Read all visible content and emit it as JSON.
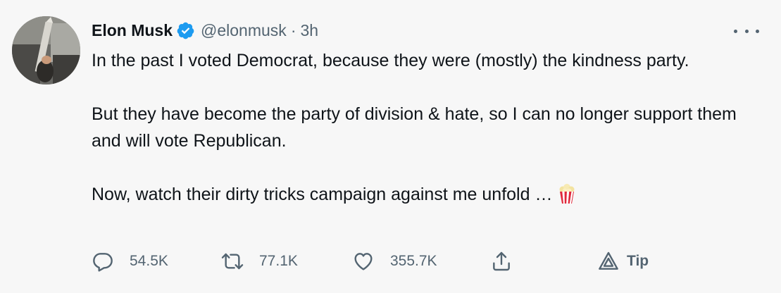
{
  "author": {
    "name": "Elon Musk",
    "handle": "@elonmusk",
    "separator": "·",
    "time": "3h",
    "verified": true,
    "avatar_icon": "avatar-photo"
  },
  "tweet": {
    "paragraphs": [
      "In the past I voted Democrat, because they were (mostly) the kindness party.",
      "But they have become the party of division & hate, so I can no longer support them and will vote Republican.",
      "Now, watch their dirty tricks campaign against me unfold …"
    ],
    "emoji": "popcorn"
  },
  "actions": {
    "reply_count": "54.5K",
    "retweet_count": "77.1K",
    "like_count": "355.7K",
    "tip_label": "Tip"
  },
  "colors": {
    "background": "#f7f7f7",
    "text": "#0f1419",
    "secondary": "#536471",
    "verified": "#1d9bf0"
  }
}
